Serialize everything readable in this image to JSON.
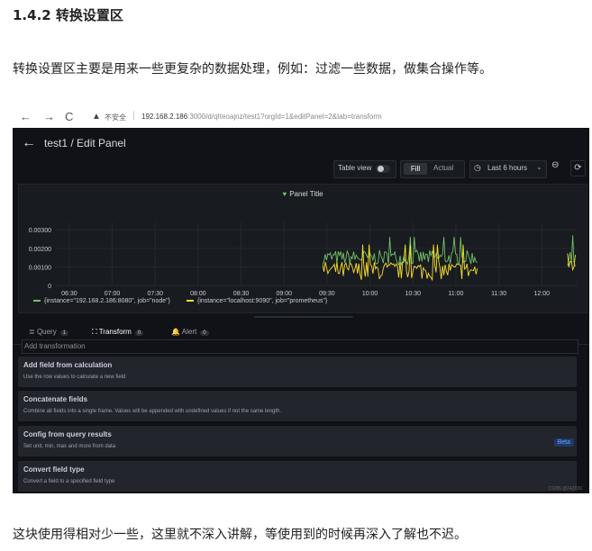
{
  "article": {
    "heading": "1.4.2 转换设置区",
    "intro": "转换设置区主要是用来一些更复杂的数据处理，例如：过滤一些数据，做集合操作等。",
    "outro": "这块使用得相对少一些，这里就不深入讲解，等使用到的时候再深入了解也不迟。"
  },
  "browser": {
    "back": "←",
    "forward": "→",
    "reload": "C",
    "warning_icon": "warning-icon",
    "insecure_label": "不安全",
    "separator": "|",
    "url_host": "192.168.2.186",
    "url_rest": ":3000/d/qIteoajnz/test1?orgId=1&editPanel=2&tab=transform"
  },
  "app": {
    "back_arrow": "←",
    "breadcrumb": "test1 / Edit Panel",
    "table_view_label": "Table view",
    "table_view_on": false,
    "fill_label": "Fill",
    "actual_label": "Actual",
    "clock_icon": "◷",
    "time_range": "Last 6 hours",
    "chevron": "⌄",
    "zoom_icon": "⊖",
    "refresh_icon": "⟳",
    "panel_title": "Panel Title",
    "heart": "♥",
    "tabs": [
      {
        "label": "Query",
        "count": "1",
        "icon": "≣"
      },
      {
        "label": "Transform",
        "count": "0",
        "icon": "⛶"
      },
      {
        "label": "Alert",
        "count": "0",
        "icon": "🔔"
      }
    ],
    "add_transformation": "Add transformation",
    "transformations": [
      {
        "title": "Add field from calculation",
        "desc": "Use the row values to calculate a new field",
        "badge": ""
      },
      {
        "title": "Concatenate fields",
        "desc": "Combine all fields into a single frame. Values will be appended with undefined values if not the same length.",
        "badge": ""
      },
      {
        "title": "Config from query results",
        "desc": "Set unit, min, max and more from data",
        "badge": "Beta"
      },
      {
        "title": "Convert field type",
        "desc": "Convert a field to a specified field type",
        "badge": ""
      }
    ],
    "watermark": "CSDN @24Z030"
  },
  "chart_data": {
    "type": "line",
    "title": "Panel Title",
    "x_ticks": [
      "06:30",
      "07:00",
      "07:30",
      "08:00",
      "08:30",
      "09:00",
      "09:30",
      "10:00",
      "10:30",
      "11:00",
      "11:30",
      "12:00"
    ],
    "y_ticks": [
      "0",
      "0.00100",
      "0.00200",
      "0.00300"
    ],
    "ylim": [
      0,
      0.0034
    ],
    "series": [
      {
        "name": "{instance=\"192.168.2.186:8080\", job=\"node\"}",
        "color": "#73bf69",
        "segments": [
          {
            "x_start": "09:27",
            "x_end": "11:15",
            "approx_level": 0.0015,
            "noise": 0.0004
          },
          {
            "x_start": "12:18",
            "x_end": "12:24",
            "approx_level": 0.0013,
            "noise": 0.0005
          }
        ]
      },
      {
        "name": "{instance=\"localhost:9090\", job=\"prometheus\"}",
        "color": "#fade2a",
        "segments": [
          {
            "x_start": "09:27",
            "x_end": "11:15",
            "approx_level": 0.0008,
            "noise": 0.0005
          },
          {
            "x_start": "12:18",
            "x_end": "12:24",
            "approx_level": 0.0012,
            "noise": 0.0006
          }
        ]
      }
    ],
    "grid": true,
    "legend": "bottom-left"
  }
}
